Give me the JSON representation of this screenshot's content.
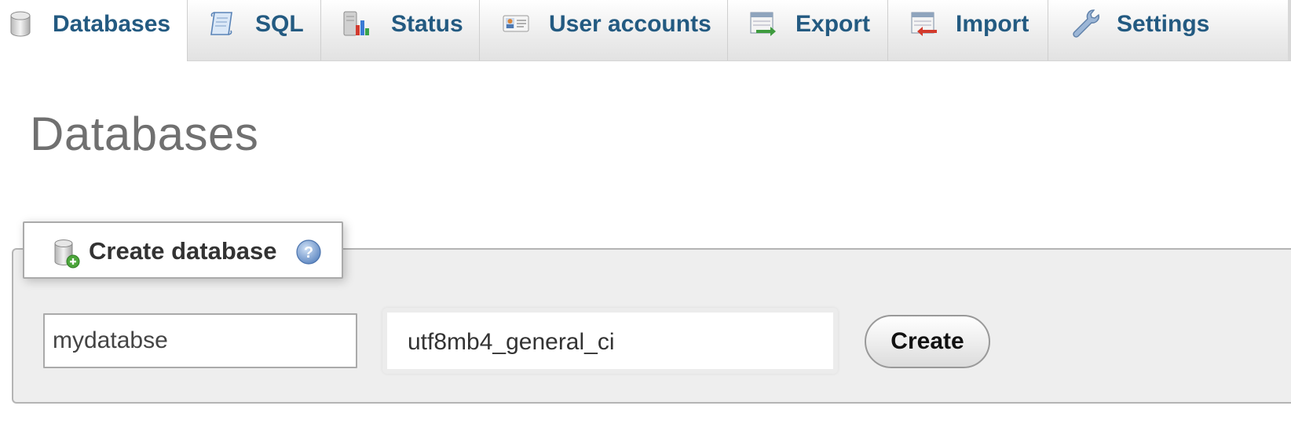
{
  "tabs": [
    {
      "id": "databases",
      "label": "Databases",
      "icon": "database-icon",
      "active": true
    },
    {
      "id": "sql",
      "label": "SQL",
      "icon": "sql-scroll-icon",
      "active": false
    },
    {
      "id": "status",
      "label": "Status",
      "icon": "status-chart-icon",
      "active": false
    },
    {
      "id": "user-accounts",
      "label": "User accounts",
      "icon": "user-card-icon",
      "active": false
    },
    {
      "id": "export",
      "label": "Export",
      "icon": "export-icon",
      "active": false
    },
    {
      "id": "import",
      "label": "Import",
      "icon": "import-icon",
      "active": false
    },
    {
      "id": "settings",
      "label": "Settings",
      "icon": "wrench-icon",
      "active": false
    }
  ],
  "page": {
    "title": "Databases"
  },
  "create_database": {
    "legend": "Create database",
    "help_icon": "help-icon",
    "name_value": "mydatabse",
    "collation_value": "utf8mb4_general_ci",
    "create_label": "Create"
  },
  "colors": {
    "tab_text": "#235a81",
    "title_text": "#707070",
    "fieldset_bg": "#eeeeee"
  }
}
